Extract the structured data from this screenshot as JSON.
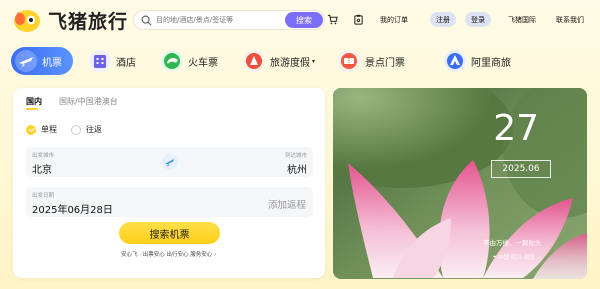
{
  "header": {
    "logo_text": "飞猪旅行",
    "search_placeholder": "目的地/酒店/景点/签证等",
    "search_button": "搜索",
    "my_orders": "我的订单",
    "register": "注册",
    "login": "登录",
    "intl": "飞猪国际",
    "contact": "联系我们"
  },
  "categories": [
    {
      "label": "机票",
      "icon": "plane-icon",
      "active": true
    },
    {
      "label": "酒店",
      "icon": "hotel-icon",
      "active": false
    },
    {
      "label": "火车票",
      "icon": "train-icon",
      "active": false
    },
    {
      "label": "旅游度假",
      "icon": "vacation-icon",
      "active": false,
      "has_dropdown": true
    },
    {
      "label": "景点门票",
      "icon": "ticket-icon",
      "active": false
    },
    {
      "label": "阿里商旅",
      "icon": "business-icon",
      "active": false
    }
  ],
  "booking": {
    "tabs": [
      {
        "label": "国内",
        "active": true
      },
      {
        "label": "国际/中国港澳台",
        "active": false
      }
    ],
    "trip_types": [
      {
        "label": "单程",
        "checked": true
      },
      {
        "label": "往返",
        "checked": false
      }
    ],
    "depart_label": "出发城市",
    "depart_value": "北京",
    "arrive_label": "到达城市",
    "arrive_value": "杭州",
    "date_label": "出发日期",
    "date_value": "2025年06月28日",
    "add_return": "添加返程",
    "search_button": "搜索机票",
    "assurance": "安心飞 · 出票安心 出行安心 服务安心 ›"
  },
  "banner": {
    "day": "27",
    "month": "2025.06",
    "quote": "芊由万缕，一颗砍头",
    "location": "中国·绍兴·沈园"
  },
  "colors": {
    "accent_purple": "#7b6df6",
    "accent_yellow": "#ffd22e",
    "active_blue": "#3a6df2"
  }
}
